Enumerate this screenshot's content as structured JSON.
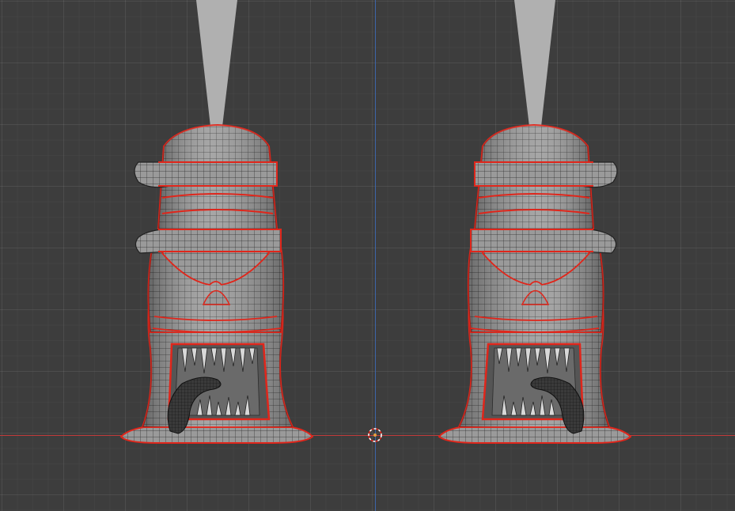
{
  "viewport": {
    "name": "3D Viewport",
    "background_color": "#3d3d3d",
    "grid_color": "#4a4a4a",
    "x_axis_color": "#c13a3a",
    "z_axis_color": "#3d65a8",
    "selection_outline_color": "#e0261b"
  },
  "scene_objects": [
    {
      "name": "boot-left-icon",
      "kind": "mesh"
    },
    {
      "name": "boot-right-icon",
      "kind": "mesh"
    },
    {
      "name": "3d-cursor-icon",
      "kind": "cursor"
    }
  ]
}
